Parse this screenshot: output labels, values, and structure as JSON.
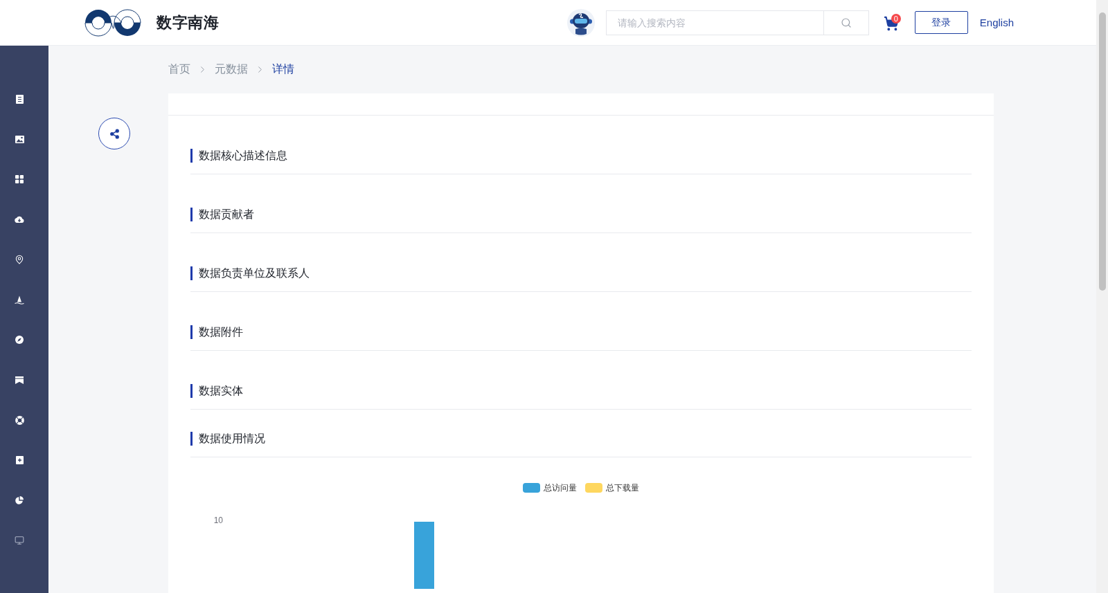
{
  "header": {
    "site_title": "数字南海",
    "search": {
      "placeholder": "请输入搜索内容"
    },
    "cart": {
      "badge": "0"
    },
    "login_button": "登录",
    "language_link": "English"
  },
  "sidebar": {
    "items": [
      {
        "kind": "document"
      },
      {
        "kind": "image"
      },
      {
        "kind": "grid"
      },
      {
        "kind": "cloud"
      },
      {
        "kind": "pin"
      },
      {
        "kind": "sailboat"
      },
      {
        "kind": "compass"
      },
      {
        "kind": "banner"
      },
      {
        "kind": "lifebuoy"
      },
      {
        "kind": "plus"
      },
      {
        "kind": "pie"
      },
      {
        "kind": "monitor"
      }
    ]
  },
  "breadcrumb": [
    {
      "label": "首页",
      "current": false
    },
    {
      "label": "元数据",
      "current": false
    },
    {
      "label": "详情",
      "current": true
    }
  ],
  "sections": [
    {
      "title": "数据核心描述信息"
    },
    {
      "title": "数据贡献者"
    },
    {
      "title": "数据负责单位及联系人"
    },
    {
      "title": "数据附件"
    },
    {
      "title": "数据实体"
    },
    {
      "title": "数据使用情况",
      "usage_chart": {
        "legend": [
          {
            "label": "总访问量",
            "color": "#38a3da"
          },
          {
            "label": "总下载量",
            "color": "#fed75f"
          }
        ],
        "y_axis_label": "10"
      }
    }
  ]
}
